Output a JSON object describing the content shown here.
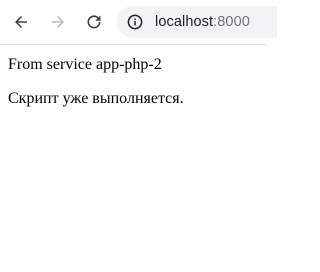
{
  "toolbar": {
    "back_icon": "arrow-left-icon",
    "forward_icon": "arrow-right-icon",
    "reload_icon": "reload-icon",
    "site_info_icon": "info-circle-icon",
    "url_host": "localhost",
    "url_port": ":8000",
    "icon_color_active": "#3c4043",
    "icon_color_disabled": "#b9bcbf",
    "omnibox_bg": "#f1f3f4"
  },
  "page": {
    "line1": "From service app-php-2",
    "line2": "Скрипт уже выполняется."
  }
}
